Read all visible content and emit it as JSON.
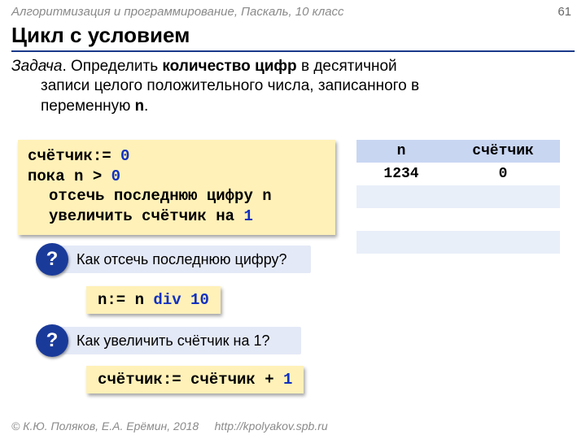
{
  "header": {
    "course": "Алгоритмизация и программирование, Паскаль, 10 класс",
    "page": "61"
  },
  "title": "Цикл с условием",
  "task": {
    "lead": "Задача",
    "sep": ". Определить ",
    "bold": "количество цифр",
    "rest1": " в десятичной",
    "line2a": "записи целого положительного числа, записанного в",
    "line2b": "переменную ",
    "var": "n",
    "dot": "."
  },
  "code": {
    "l1a": "счётчик:= ",
    "l1b": "0",
    "l2a": "пока n > ",
    "l2b": "0",
    "l3": "отсечь последнюю цифру n",
    "l4a": "увеличить счётчик на ",
    "l4b": "1"
  },
  "table": {
    "h1": "n",
    "h2": "счётчик",
    "rows": [
      {
        "n": "1234",
        "c": "0"
      },
      {
        "n": "",
        "c": ""
      },
      {
        "n": "",
        "c": ""
      },
      {
        "n": "",
        "c": ""
      }
    ]
  },
  "q1": {
    "badge": "?",
    "text": "Как отсечь последнюю цифру?"
  },
  "snippet1": {
    "a": "n:= n ",
    "kw": "div",
    "b": " 10"
  },
  "q2": {
    "badge": "?",
    "text": "Как увеличить счётчик на 1?"
  },
  "snippet2": {
    "a": "счётчик:= счётчик + ",
    "num": "1"
  },
  "footer": {
    "copy": "© К.Ю. Поляков, Е.А. Ерёмин, 2018",
    "url": "http://kpolyakov.spb.ru"
  }
}
